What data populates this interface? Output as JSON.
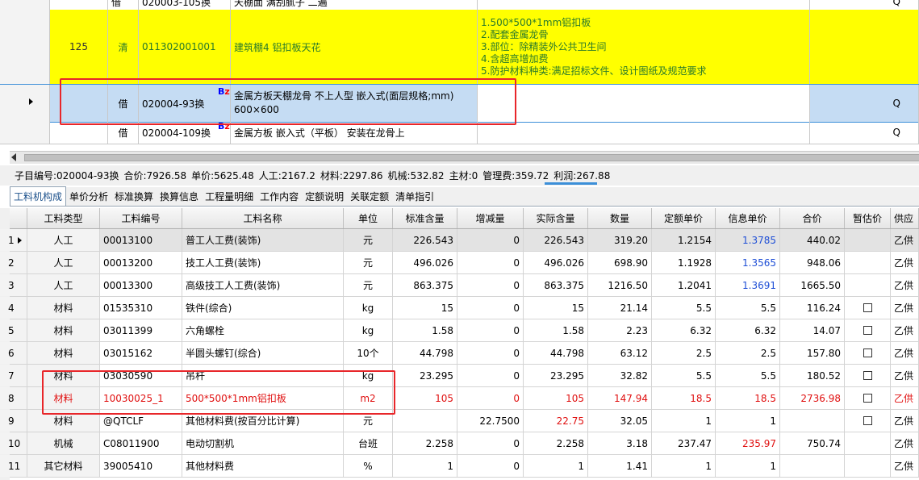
{
  "upper": {
    "rows": [
      {
        "col1": "借",
        "code": "020003-105换",
        "name": "天棚面 满刮腻子 二遍",
        "unit": "Q"
      },
      {
        "index": "125",
        "type": "清",
        "code": "011302001001",
        "name": "建筑棚4 铝扣板天花",
        "desc": [
          "1.500*500*1mm铝扣板",
          "2.配套金属龙骨",
          "3.部位：除精装外公共卫生间",
          "4.含超高增加费",
          "5.防护材料种类:满足招标文件、设计图纸及规范要求"
        ],
        "expander": "⊟"
      },
      {
        "type": "借",
        "code": "020004-93换",
        "name_line1": "金属方板天棚龙骨 不上人型 嵌入式(面层规格;mm)",
        "name_line2": "600×600",
        "unit": "Q",
        "badge_b": "B",
        "badge_z": "z"
      },
      {
        "type": "借",
        "code": "020004-109换",
        "name": "金属方板 嵌入式（平板） 安装在龙骨上",
        "unit": "Q",
        "badge_b": "B",
        "badge_z": "z"
      }
    ]
  },
  "summary": [
    "子目编号:020004-93换",
    "合价:7926.58",
    "单价:5625.48",
    "人工:2167.2",
    "材料:2297.86",
    "机械:532.82",
    "主材:0",
    "管理费:359.72",
    "利润:267.88"
  ],
  "tabs": [
    "工料机构成",
    "单价分析",
    "标准换算",
    "换算信息",
    "工程量明细",
    "工作内容",
    "定额说明",
    "关联定额",
    "清单指引"
  ],
  "grid": {
    "headers": [
      "工料类型",
      "工料编号",
      "工料名称",
      "单位",
      "标准含量",
      "增减量",
      "实际含量",
      "数量",
      "定额单价",
      "信息单价",
      "合价",
      "暂估价",
      "供应"
    ],
    "rows": [
      {
        "n": "1",
        "type": "人工",
        "code": "00013100",
        "name": "普工人工费(装饰)",
        "unit": "元",
        "std": "226.543",
        "adj": "0",
        "act": "226.543",
        "qty": "319.20",
        "qp": "1.2154",
        "ip": "1.3785",
        "total": "440.02",
        "supply": "乙供"
      },
      {
        "n": "2",
        "type": "人工",
        "code": "00013200",
        "name": "技工人工费(装饰)",
        "unit": "元",
        "std": "496.026",
        "adj": "0",
        "act": "496.026",
        "qty": "698.90",
        "qp": "1.1928",
        "ip": "1.3565",
        "total": "948.06",
        "supply": "乙供"
      },
      {
        "n": "3",
        "type": "人工",
        "code": "00013300",
        "name": "高级技工人工费(装饰)",
        "unit": "元",
        "std": "863.375",
        "adj": "0",
        "act": "863.375",
        "qty": "1216.50",
        "qp": "1.2041",
        "ip": "1.3691",
        "total": "1665.50",
        "supply": "乙供"
      },
      {
        "n": "4",
        "type": "材料",
        "code": "01535310",
        "name": "铁件(综合)",
        "unit": "kg",
        "std": "15",
        "adj": "0",
        "act": "15",
        "qty": "21.14",
        "qp": "5.5",
        "ip": "5.5",
        "total": "116.24",
        "supply": "乙供"
      },
      {
        "n": "5",
        "type": "材料",
        "code": "03011399",
        "name": "六角螺栓",
        "unit": "kg",
        "std": "1.58",
        "adj": "0",
        "act": "1.58",
        "qty": "2.23",
        "qp": "6.32",
        "ip": "6.32",
        "total": "14.07",
        "supply": "乙供"
      },
      {
        "n": "6",
        "type": "材料",
        "code": "03015162",
        "name": "半圆头螺钉(综合)",
        "unit": "10个",
        "std": "44.798",
        "adj": "0",
        "act": "44.798",
        "qty": "63.12",
        "qp": "2.5",
        "ip": "2.5",
        "total": "157.80",
        "supply": "乙供"
      },
      {
        "n": "7",
        "type": "材料",
        "code": "03030590",
        "name": "吊杆",
        "unit": "kg",
        "std": "23.295",
        "adj": "0",
        "act": "23.295",
        "qty": "32.82",
        "qp": "5.5",
        "ip": "5.5",
        "total": "180.52",
        "supply": "乙供"
      },
      {
        "n": "8",
        "type": "材料",
        "code": "10030025_1",
        "name": "500*500*1mm铝扣板",
        "unit": "m2",
        "std": "105",
        "adj": "0",
        "act": "105",
        "qty": "147.94",
        "qp": "18.5",
        "ip": "18.5",
        "total": "2736.98",
        "supply": "乙供"
      },
      {
        "n": "9",
        "type": "材料",
        "code": "@QTCLF",
        "name": "其他材料费(按百分比计算)",
        "unit": "元",
        "std": "",
        "adj": "22.7500",
        "act": "22.75",
        "qty": "32.05",
        "qp": "1",
        "ip": "1",
        "total": "",
        "supply": "乙供"
      },
      {
        "n": "10",
        "type": "机械",
        "code": "C08011900",
        "name": "电动切割机",
        "unit": "台班",
        "std": "2.258",
        "adj": "0",
        "act": "2.258",
        "qty": "3.18",
        "qp": "237.47",
        "ip": "235.97",
        "total": "750.74",
        "supply": "乙供",
        "expander": "⊞"
      },
      {
        "n": "11",
        "type": "其它材料",
        "code": "39005410",
        "name": "其他材料费",
        "unit": "%",
        "std": "1",
        "adj": "0",
        "act": "1",
        "qty": "1.41",
        "qp": "1",
        "ip": "1",
        "total": "",
        "supply": "乙供"
      }
    ]
  },
  "colors": {
    "yellow": "#ffff00",
    "selected_row": "#c5dcf3",
    "highlight_red": "#e8262a",
    "info_price_blue": "#1f4fd6"
  }
}
